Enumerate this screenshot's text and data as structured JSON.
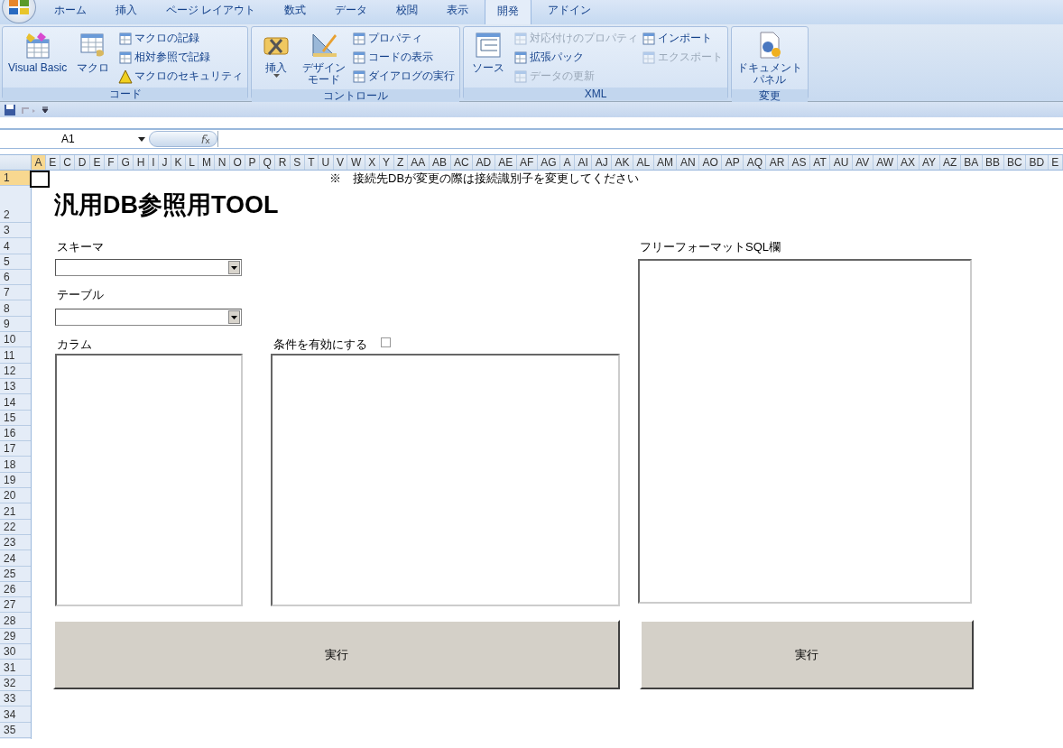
{
  "tabs": [
    {
      "label": "ホーム",
      "selected": false
    },
    {
      "label": "挿入",
      "selected": false
    },
    {
      "label": "ページ レイアウト",
      "selected": false
    },
    {
      "label": "数式",
      "selected": false
    },
    {
      "label": "データ",
      "selected": false
    },
    {
      "label": "校閲",
      "selected": false
    },
    {
      "label": "表示",
      "selected": false
    },
    {
      "label": "開発",
      "selected": true
    },
    {
      "label": "アドイン",
      "selected": false
    }
  ],
  "ribbon_groups": [
    {
      "name": "コード",
      "large": [
        {
          "label": "Visual Basic",
          "dropdown": false
        },
        {
          "label": "マクロ",
          "dropdown": false
        }
      ],
      "small": [
        {
          "label": "マクロの記録",
          "disabled": false
        },
        {
          "label": "相対参照で記録",
          "disabled": false
        },
        {
          "label": "マクロのセキュリティ",
          "disabled": false
        }
      ]
    },
    {
      "name": "コントロール",
      "large": [
        {
          "label": "挿入",
          "dropdown": true
        },
        {
          "label": "デザインモード",
          "dropdown": false
        }
      ],
      "small": [
        {
          "label": "プロパティ",
          "disabled": false
        },
        {
          "label": "コードの表示",
          "disabled": false
        },
        {
          "label": "ダイアログの実行",
          "disabled": false
        }
      ]
    },
    {
      "name": "XML",
      "large": [
        {
          "label": "ソース",
          "dropdown": false
        }
      ],
      "small": [
        {
          "label": "対応付けのプロパティ",
          "disabled": true
        },
        {
          "label": "拡張パック",
          "disabled": false
        },
        {
          "label": "データの更新",
          "disabled": true
        },
        {
          "label": "インポート",
          "disabled": false
        },
        {
          "label": "エクスポート",
          "disabled": true
        }
      ]
    },
    {
      "name": "変更",
      "large": [
        {
          "label": "ドキュメントパネル",
          "dropdown": false
        }
      ]
    }
  ],
  "name_box": "A1",
  "columns": [
    {
      "label": "A",
      "selected": true
    },
    {
      "label": "E",
      "selected": false
    },
    {
      "label": "C",
      "selected": false
    },
    {
      "label": "D",
      "selected": false
    },
    {
      "label": "E",
      "selected": false
    },
    {
      "label": "F",
      "selected": false
    },
    {
      "label": "G",
      "selected": false
    },
    {
      "label": "H",
      "selected": false
    },
    {
      "label": "I",
      "selected": false
    },
    {
      "label": "J",
      "selected": false
    },
    {
      "label": "K",
      "selected": false
    },
    {
      "label": "L",
      "selected": false
    },
    {
      "label": "M",
      "selected": false
    },
    {
      "label": "N",
      "selected": false
    },
    {
      "label": "O",
      "selected": false
    },
    {
      "label": "P",
      "selected": false
    },
    {
      "label": "Q",
      "selected": false
    },
    {
      "label": "R",
      "selected": false
    },
    {
      "label": "S",
      "selected": false
    },
    {
      "label": "T",
      "selected": false
    },
    {
      "label": "U",
      "selected": false
    },
    {
      "label": "V",
      "selected": false
    },
    {
      "label": "W",
      "selected": false
    },
    {
      "label": "X",
      "selected": false
    },
    {
      "label": "Y",
      "selected": false
    },
    {
      "label": "Z",
      "selected": false
    },
    {
      "label": "AA",
      "selected": false
    },
    {
      "label": "AB",
      "selected": false
    },
    {
      "label": "AC",
      "selected": false
    },
    {
      "label": "AD",
      "selected": false
    },
    {
      "label": "AE",
      "selected": false
    },
    {
      "label": "AF",
      "selected": false
    },
    {
      "label": "AG",
      "selected": false
    },
    {
      "label": "A",
      "selected": false
    },
    {
      "label": "AI",
      "selected": false
    },
    {
      "label": "AJ",
      "selected": false
    },
    {
      "label": "AK",
      "selected": false
    },
    {
      "label": "AL",
      "selected": false
    },
    {
      "label": "AM",
      "selected": false
    },
    {
      "label": "AN",
      "selected": false
    },
    {
      "label": "AO",
      "selected": false
    },
    {
      "label": "AP",
      "selected": false
    },
    {
      "label": "AQ",
      "selected": false
    },
    {
      "label": "AR",
      "selected": false
    },
    {
      "label": "AS",
      "selected": false
    },
    {
      "label": "AT",
      "selected": false
    },
    {
      "label": "AU",
      "selected": false
    },
    {
      "label": "AV",
      "selected": false
    },
    {
      "label": "AW",
      "selected": false
    },
    {
      "label": "AX",
      "selected": false
    },
    {
      "label": "AY",
      "selected": false
    },
    {
      "label": "AZ",
      "selected": false
    },
    {
      "label": "BA",
      "selected": false
    },
    {
      "label": "BB",
      "selected": false
    },
    {
      "label": "BC",
      "selected": false
    },
    {
      "label": "BD",
      "selected": false
    },
    {
      "label": "E",
      "selected": false
    }
  ],
  "rows": [
    {
      "label": "1",
      "selected": true
    },
    {
      "label": "2",
      "selected": false
    },
    {
      "label": "3",
      "selected": false
    },
    {
      "label": "4",
      "selected": false
    },
    {
      "label": "5",
      "selected": false
    },
    {
      "label": "6",
      "selected": false
    },
    {
      "label": "7",
      "selected": false
    },
    {
      "label": "8",
      "selected": false
    },
    {
      "label": "9",
      "selected": false
    },
    {
      "label": "10",
      "selected": false
    },
    {
      "label": "11",
      "selected": false
    },
    {
      "label": "12",
      "selected": false
    },
    {
      "label": "13",
      "selected": false
    },
    {
      "label": "14",
      "selected": false
    },
    {
      "label": "15",
      "selected": false
    },
    {
      "label": "16",
      "selected": false
    },
    {
      "label": "17",
      "selected": false
    },
    {
      "label": "18",
      "selected": false
    },
    {
      "label": "19",
      "selected": false
    },
    {
      "label": "20",
      "selected": false
    },
    {
      "label": "21",
      "selected": false
    },
    {
      "label": "22",
      "selected": false
    },
    {
      "label": "23",
      "selected": false
    },
    {
      "label": "24",
      "selected": false
    },
    {
      "label": "25",
      "selected": false
    },
    {
      "label": "26",
      "selected": false
    },
    {
      "label": "27",
      "selected": false
    },
    {
      "label": "28",
      "selected": false
    },
    {
      "label": "29",
      "selected": false
    },
    {
      "label": "30",
      "selected": false
    },
    {
      "label": "31",
      "selected": false
    },
    {
      "label": "32",
      "selected": false
    },
    {
      "label": "33",
      "selected": false
    },
    {
      "label": "34",
      "selected": false
    },
    {
      "label": "35",
      "selected": false
    }
  ],
  "sheet": {
    "note": "※　接続先DBが変更の際は接続識別子を変更してください",
    "title": "汎用DB参照用TOOL",
    "schema_label": "スキーマ",
    "table_label": "テーブル",
    "column_label": "カラム",
    "condition": {
      "label": "条件を有効にする",
      "checked": false
    },
    "free_sql_label": "フリーフォーマットSQL欄",
    "buttons": [
      "実行",
      "実行"
    ]
  }
}
